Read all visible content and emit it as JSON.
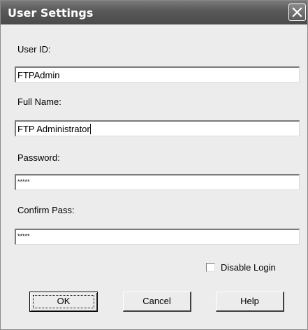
{
  "window": {
    "title": "User Settings"
  },
  "form": {
    "user_id": {
      "label": "User ID:",
      "value": "FTPAdmin"
    },
    "full_name": {
      "label": "Full Name:",
      "value": "FTP Administrator"
    },
    "password": {
      "label": "Password:",
      "value": "*****"
    },
    "confirm": {
      "label": "Confirm Pass:",
      "value": "*****"
    },
    "disable_login": {
      "label": "Disable Login",
      "checked": false
    }
  },
  "buttons": {
    "ok": "OK",
    "cancel": "Cancel",
    "help": "Help"
  }
}
